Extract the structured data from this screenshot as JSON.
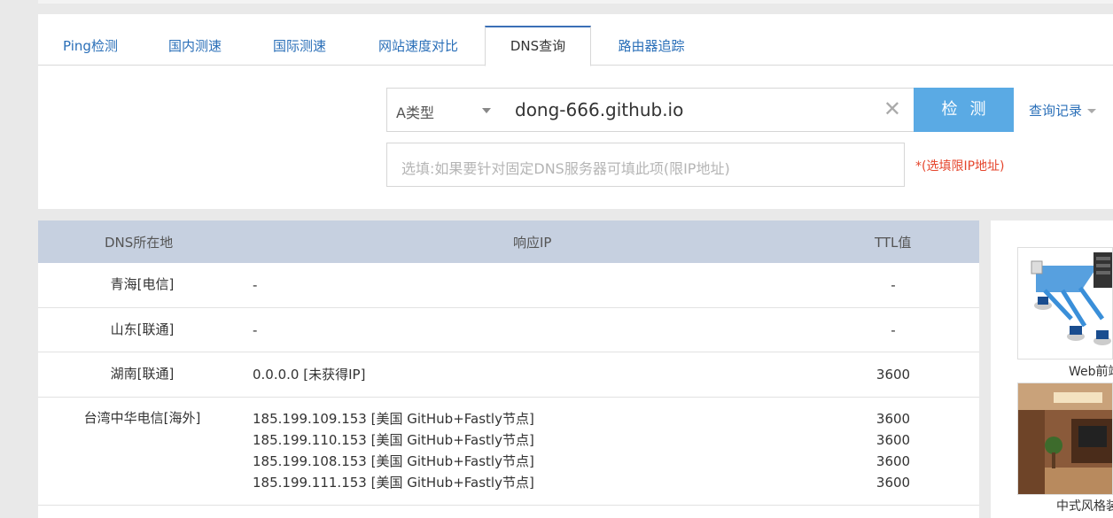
{
  "tabs": [
    {
      "label": "Ping检测"
    },
    {
      "label": "国内测速"
    },
    {
      "label": "国际测速"
    },
    {
      "label": "网站速度对比"
    },
    {
      "label": "DNS查询"
    },
    {
      "label": "路由器追踪"
    }
  ],
  "active_tab": "DNS查询",
  "query": {
    "type_value": "A类型",
    "domain_value": "dong-666.github.io",
    "search_label": "检测",
    "history_label": "查询记录",
    "dns_placeholder": "选填:如果要针对固定DNS服务器可填此项(限IP地址)",
    "dns_note": "*(选填限IP地址)"
  },
  "table": {
    "headers": [
      "DNS所在地",
      "响应IP",
      "TTL值"
    ],
    "rows": [
      {
        "location": "青海[电信]",
        "ips": [
          "-"
        ],
        "ttls": [
          "-"
        ]
      },
      {
        "location": "山东[联通]",
        "ips": [
          "-"
        ],
        "ttls": [
          "-"
        ]
      },
      {
        "location": "湖南[联通]",
        "ips": [
          "0.0.0.0 [未获得IP]"
        ],
        "ttls": [
          "3600"
        ]
      },
      {
        "location": "台湾中华电信[海外]",
        "ips": [
          "185.199.109.153 [美国 GitHub+Fastly节点]",
          "185.199.110.153 [美国 GitHub+Fastly节点]",
          "185.199.108.153 [美国 GitHub+Fastly节点]",
          "185.199.111.153 [美国 GitHub+Fastly节点]"
        ],
        "ttls": [
          "3600",
          "3600",
          "3600",
          "3600"
        ]
      }
    ]
  },
  "sidebar": {
    "ad1_caption": "Web前端",
    "ad2_caption": "中式风格装"
  },
  "colors": {
    "link": "#2a6fb8",
    "button": "#5aaae4",
    "header_bg": "#c6d0e0",
    "note": "#e5462d"
  }
}
